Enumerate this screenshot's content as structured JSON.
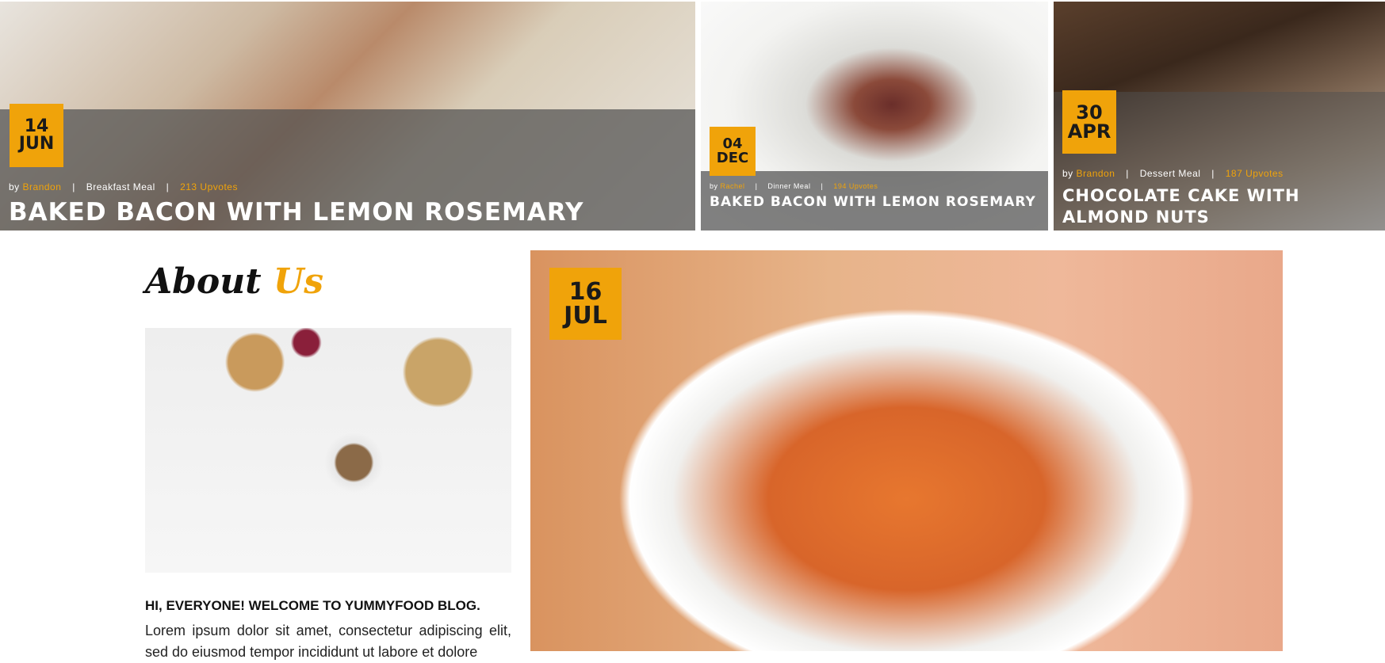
{
  "posts": [
    {
      "day": "14",
      "month": "JUN",
      "by_label": "by",
      "author": "Brandon",
      "category": "Breakfast Meal",
      "upvotes": "213 Upvotes",
      "title": "BAKED BACON WITH LEMON ROSEMARY"
    },
    {
      "day": "04",
      "month": "DEC",
      "by_label": "by",
      "author": "Rachel",
      "category": "Dinner Meal",
      "upvotes": "194 Upvotes",
      "title": "BAKED BACON WITH LEMON ROSEMARY"
    },
    {
      "day": "30",
      "month": "APR",
      "by_label": "by",
      "author": "Brandon",
      "category": "Dessert Meal",
      "upvotes": "187 Upvotes",
      "title": "CHOCOLATE CAKE WITH ALMOND NUTS"
    }
  ],
  "meta_separator": "|",
  "about": {
    "heading_main": "About",
    "heading_accent": "Us",
    "subtitle": "HI, EVERYONE! WELCOME TO YUMMYFOOD BLOG.",
    "body": "Lorem ipsum dolor sit amet, consectetur adipiscing elit, sed do eiusmod tempor incididunt ut labore et dolore"
  },
  "featured": {
    "day": "16",
    "month": "JUL"
  },
  "colors": {
    "accent": "#f0a30a",
    "overlay": "#505050"
  }
}
